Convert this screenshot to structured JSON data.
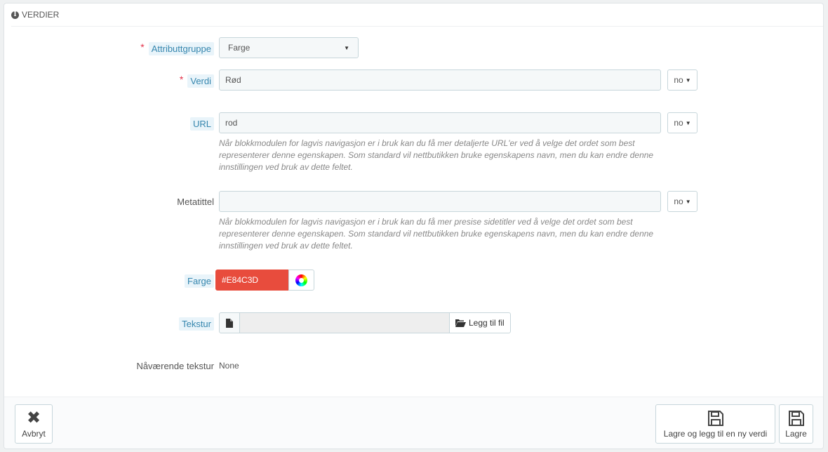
{
  "panel": {
    "title": "Verdier",
    "info_glyph": "i"
  },
  "fields": {
    "group": {
      "label": "Attributtgruppe",
      "value": "Farge"
    },
    "value": {
      "label": "Verdi",
      "value": "Rød",
      "lang": "no"
    },
    "url": {
      "label": "URL",
      "value": "rod",
      "lang": "no",
      "help": "Når blokkmodulen for lagvis navigasjon er i bruk kan du få mer detaljerte URL'er ved å velge det ordet som best representerer denne egenskapen. Som standard vil nettbutikken bruke egenskapens navn, men du kan endre denne innstillingen ved bruk av dette feltet."
    },
    "meta_title": {
      "label": "Metatittel",
      "value": "",
      "lang": "no",
      "help": "Når blokkmodulen for lagvis navigasjon er i bruk kan du få mer presise sidetitler ved å velge det ordet som best representerer denne egenskapen. Som standard vil nettbutikken bruke egenskapens navn, men du kan endre denne innstillingen ved bruk av dette feltet."
    },
    "color": {
      "label": "Farge",
      "value": "#E84C3D",
      "swatch": "#e84c3d"
    },
    "texture": {
      "label": "Tekstur",
      "button": "Legg til fil"
    },
    "current_texture": {
      "label": "Nåværende tekstur",
      "value": "None"
    }
  },
  "required_mark": "*",
  "footer": {
    "cancel": "Avbryt",
    "save_and_add": "Lagre og legg til en ny verdi",
    "save": "Lagre"
  }
}
